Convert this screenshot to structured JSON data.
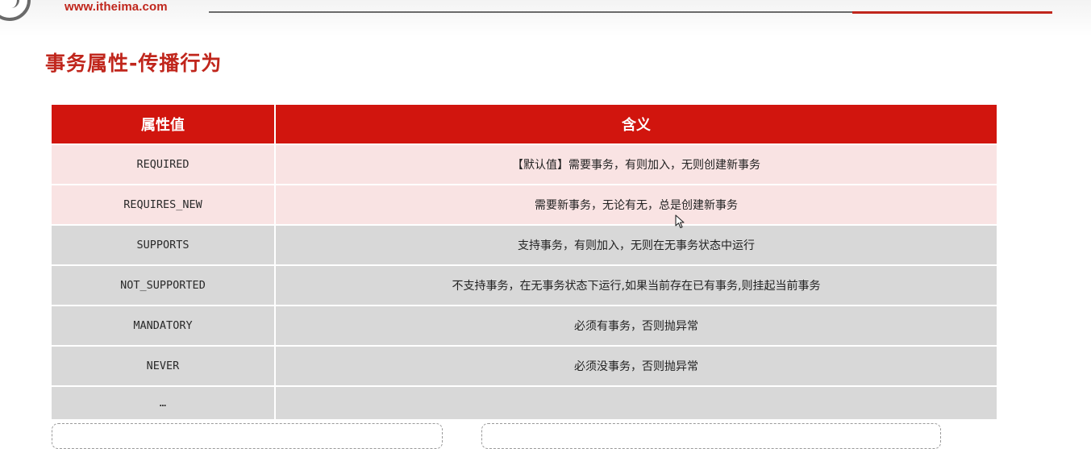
{
  "header": {
    "site_url": "www.itheima.com"
  },
  "page": {
    "title": "事务属性-传播行为"
  },
  "table": {
    "headers": [
      "属性值",
      "含义"
    ],
    "rows": [
      {
        "value": "REQUIRED",
        "meaning": "【默认值】需要事务，有则加入，无则创建新事务",
        "highlighted": true
      },
      {
        "value": "REQUIRES_NEW",
        "meaning": "需要新事务，无论有无，总是创建新事务",
        "highlighted": true
      },
      {
        "value": "SUPPORTS",
        "meaning": "支持事务，有则加入，无则在无事务状态中运行",
        "highlighted": false
      },
      {
        "value": "NOT_SUPPORTED",
        "meaning": "不支持事务，在无事务状态下运行,如果当前存在已有事务,则挂起当前事务",
        "highlighted": false
      },
      {
        "value": "MANDATORY",
        "meaning": "必须有事务，否则抛异常",
        "highlighted": false
      },
      {
        "value": "NEVER",
        "meaning": "必须没事务，否则抛异常",
        "highlighted": false
      },
      {
        "value": "…",
        "meaning": "",
        "highlighted": false
      }
    ]
  },
  "colors": {
    "accent": "#d1150e",
    "brand_text": "#c0261c",
    "highlight_row": "#f9e3e3",
    "normal_row": "#d8d8d8"
  },
  "icons": {
    "logo": "logo-icon",
    "cursor": "mouse-cursor-icon"
  }
}
